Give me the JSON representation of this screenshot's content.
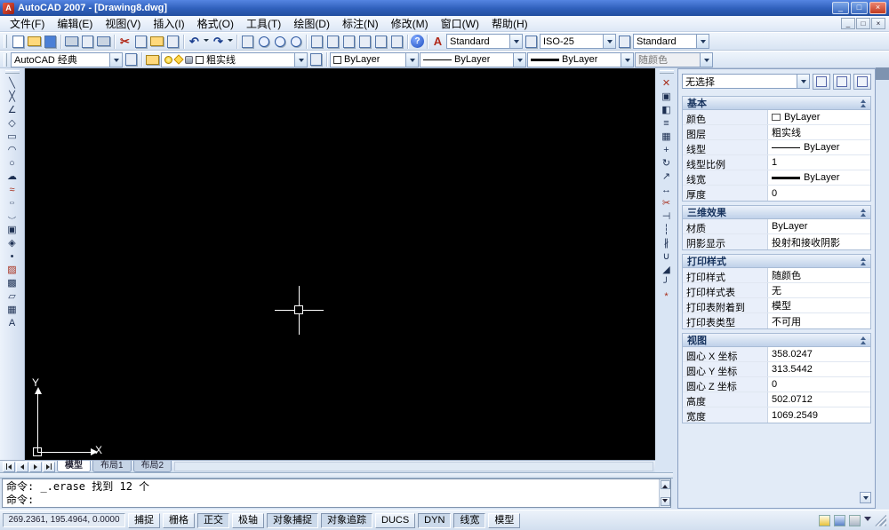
{
  "window": {
    "title": "AutoCAD 2007 - [Drawing8.dwg]",
    "controls": {
      "min": "_",
      "max": "□",
      "close": "×"
    }
  },
  "menu": {
    "items": [
      "文件(F)",
      "编辑(E)",
      "视图(V)",
      "插入(I)",
      "格式(O)",
      "工具(T)",
      "绘图(D)",
      "标注(N)",
      "修改(M)",
      "窗口(W)",
      "帮助(H)"
    ]
  },
  "toolbar1": {
    "icon_names": [
      "qnew",
      "open",
      "save",
      "plot",
      "plot-preview",
      "publish",
      "cut",
      "copy",
      "paste",
      "match-properties",
      "undo",
      "redo",
      "pan",
      "zoom-realtime",
      "zoom-window",
      "zoom-previous",
      "properties",
      "designcenter",
      "tool-palettes",
      "sheetset-manager",
      "markup-set-manager",
      "quickcalc",
      "help"
    ],
    "text_style": "Standard",
    "dim_style": "ISO-25",
    "table_style": "Standard"
  },
  "toolbar2": {
    "workspace": "AutoCAD 经典",
    "layer": "粗实线",
    "color": "ByLayer",
    "linetype": "ByLayer",
    "lineweight": "ByLayer",
    "plot_style": "随颜色"
  },
  "icons": {
    "help": "?",
    "undo": "↶",
    "redo": "↷",
    "cut": "✂",
    "text_style": "A"
  },
  "draw": {
    "icons": [
      {
        "name": "line",
        "g": "╲"
      },
      {
        "name": "construction-line",
        "g": "╳"
      },
      {
        "name": "polyline",
        "g": "∠"
      },
      {
        "name": "polygon",
        "g": "◇"
      },
      {
        "name": "rectangle",
        "g": "▭"
      },
      {
        "name": "arc",
        "g": "◠"
      },
      {
        "name": "circle",
        "g": "○"
      },
      {
        "name": "revision-cloud",
        "g": "☁"
      },
      {
        "name": "spline",
        "g": "≈"
      },
      {
        "name": "ellipse",
        "g": "○"
      },
      {
        "name": "ellipse-arc",
        "g": "◡"
      },
      {
        "name": "insert-block",
        "g": "▣"
      },
      {
        "name": "make-block",
        "g": "◈"
      },
      {
        "name": "point",
        "g": "•"
      },
      {
        "name": "hatch",
        "g": "▨"
      },
      {
        "name": "gradient",
        "g": "▩"
      },
      {
        "name": "region",
        "g": "▱"
      },
      {
        "name": "table",
        "g": "▦"
      },
      {
        "name": "multiline-text",
        "g": "A"
      }
    ]
  },
  "modify": {
    "icons": [
      {
        "name": "erase",
        "g": "✕"
      },
      {
        "name": "copy",
        "g": "▣"
      },
      {
        "name": "mirror",
        "g": "◧"
      },
      {
        "name": "offset",
        "g": "≡"
      },
      {
        "name": "array",
        "g": "▦"
      },
      {
        "name": "move",
        "g": "+"
      },
      {
        "name": "rotate",
        "g": "↻"
      },
      {
        "name": "scale",
        "g": "↗"
      },
      {
        "name": "stretch",
        "g": "↔"
      },
      {
        "name": "trim",
        "g": "✂"
      },
      {
        "name": "extend",
        "g": "⊣"
      },
      {
        "name": "break-at-point",
        "g": "┆"
      },
      {
        "name": "break",
        "g": "∦"
      },
      {
        "name": "join",
        "g": "∪"
      },
      {
        "name": "chamfer",
        "g": "◢"
      },
      {
        "name": "fillet",
        "g": "╯"
      },
      {
        "name": "explode",
        "g": "*"
      }
    ]
  },
  "canvas": {
    "tabs": [
      "模型",
      "布局1",
      "布局2"
    ],
    "active_tab": "模型",
    "ucs": {
      "x": "X",
      "y": "Y"
    }
  },
  "command": {
    "line1": "命令: _.erase 找到 12 个",
    "line2": "命令:"
  },
  "statusbar": {
    "coords": "269.2361, 195.4964, 0.0000",
    "buttons": [
      {
        "label": "捕捉",
        "pressed": false
      },
      {
        "label": "栅格",
        "pressed": false
      },
      {
        "label": "正交",
        "pressed": true
      },
      {
        "label": "极轴",
        "pressed": false
      },
      {
        "label": "对象捕捉",
        "pressed": true
      },
      {
        "label": "对象追踪",
        "pressed": true
      },
      {
        "label": "DUCS",
        "pressed": false
      },
      {
        "label": "DYN",
        "pressed": true
      },
      {
        "label": "线宽",
        "pressed": true
      },
      {
        "label": "模型",
        "pressed": false
      }
    ]
  },
  "palette": {
    "selection": "无选择",
    "swatch_color": "#ffffff",
    "sections": [
      {
        "title": "基本",
        "rows": [
          {
            "label": "颜色",
            "value": "ByLayer"
          },
          {
            "label": "图层",
            "value": "粗实线"
          },
          {
            "label": "线型",
            "value": "ByLayer"
          },
          {
            "label": "线型比例",
            "value": "1"
          },
          {
            "label": "线宽",
            "value": "ByLayer"
          },
          {
            "label": "厚度",
            "value": "0"
          }
        ]
      },
      {
        "title": "三维效果",
        "rows": [
          {
            "label": "材质",
            "value": "ByLayer"
          },
          {
            "label": "阴影显示",
            "value": "投射和接收阴影"
          }
        ]
      },
      {
        "title": "打印样式",
        "rows": [
          {
            "label": "打印样式",
            "value": "随颜色"
          },
          {
            "label": "打印样式表",
            "value": "无"
          },
          {
            "label": "打印表附着到",
            "value": "模型"
          },
          {
            "label": "打印表类型",
            "value": "不可用"
          }
        ]
      },
      {
        "title": "视图",
        "rows": [
          {
            "label": "圆心 X 坐标",
            "value": "358.0247"
          },
          {
            "label": "圆心 Y 坐标",
            "value": "313.5442"
          },
          {
            "label": "圆心 Z 坐标",
            "value": "0"
          },
          {
            "label": "高度",
            "value": "502.0712"
          },
          {
            "label": "宽度",
            "value": "1069.2549"
          }
        ]
      }
    ]
  }
}
